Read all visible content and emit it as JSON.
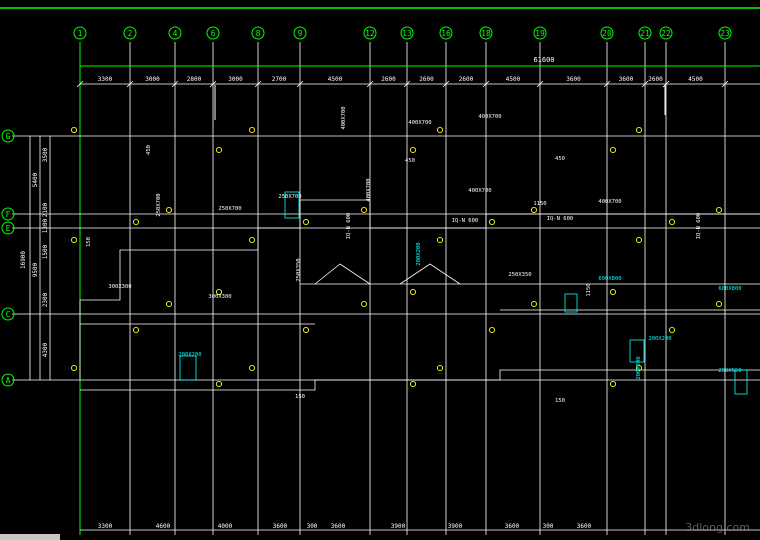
{
  "drawing": {
    "axes_top": [
      "1",
      "2",
      "4",
      "6",
      "8",
      "9",
      "12",
      "13",
      "16",
      "18",
      "19",
      "20",
      "21",
      "22",
      "23"
    ],
    "axes_left": [
      "G",
      "F",
      "E",
      "C",
      "A"
    ],
    "overall_dimension": "61600",
    "top_spacings": [
      "3300",
      "3000",
      "2800",
      "3000",
      "2700",
      "4500",
      "2600",
      "2600",
      "2600",
      "4500",
      "3600",
      "3600",
      "2600",
      "4500"
    ],
    "bottom_spacings": [
      "3300",
      "4600",
      "4000",
      "3600",
      "300",
      "3600",
      "3900",
      "3900",
      "3600",
      "300",
      "3600"
    ],
    "left_dims": [
      "3500",
      "5400",
      "2100",
      "1300",
      "1500",
      "9500",
      "2300",
      "4300",
      "16900"
    ],
    "column_labels": [
      "400X700",
      "400X700",
      "400X700",
      "400X700",
      "400X700",
      "400X700",
      "250X700",
      "250X700",
      "250X700",
      "200X200",
      "200X200",
      "200X200",
      "450",
      "450",
      "450",
      "150",
      "150",
      "150",
      "IQ-N 600",
      "IQ-N 600",
      "IQ-N 600",
      "IQ-N 600",
      "300X300",
      "300X300",
      "250X350",
      "250X350",
      "1150",
      "1150",
      "600X800",
      "600X800",
      "200X200",
      "250X550"
    ],
    "colors": {
      "background": "#000000",
      "axis_line": "#ffffff",
      "axis_bubble": "#00ff00",
      "dimension_text": "#ffffff",
      "column_marker": "#ffff00",
      "annotation_cyan": "#00ffff",
      "frame_green": "#00ff00"
    }
  },
  "watermark": "3dlong.com"
}
